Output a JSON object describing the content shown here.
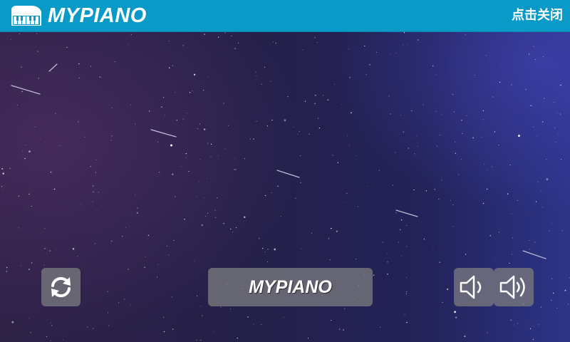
{
  "header": {
    "title": "MYPIANO",
    "close_label": "点击关闭",
    "logo_icon": "piano-icon",
    "background_color": "#099ac7"
  },
  "controls": {
    "refresh_icon": "refresh-icon",
    "center_label": "MYPIANO",
    "volume_down_icon": "volume-down-icon",
    "volume_up_icon": "volume-up-icon"
  },
  "background": {
    "scene": "starry-night-sky"
  }
}
